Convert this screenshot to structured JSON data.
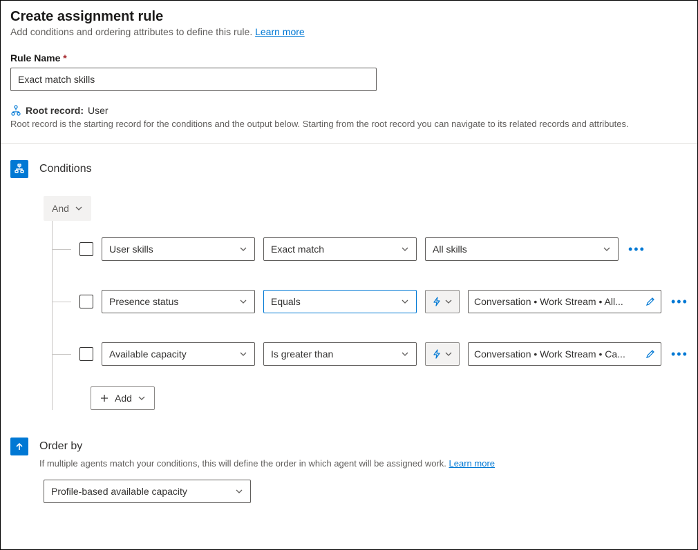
{
  "header": {
    "title": "Create assignment rule",
    "subtitle_prefix": "Add conditions and ordering attributes to define this rule. ",
    "learn_more": "Learn more"
  },
  "rule_name": {
    "label": "Rule Name",
    "required_mark": "*",
    "value": "Exact match skills"
  },
  "root_record": {
    "label": "Root record:",
    "value": "User",
    "description": "Root record is the starting record for the conditions and the output below. Starting from the root record you can navigate to its related records and attributes."
  },
  "conditions": {
    "title": "Conditions",
    "group_operator": "And",
    "rows": [
      {
        "field": "User skills",
        "operator": "Exact match",
        "value_type": "static",
        "value": "All skills"
      },
      {
        "field": "Presence status",
        "operator": "Equals",
        "operator_focused": true,
        "value_type": "dynamic",
        "value": "Conversation • Work Stream • All..."
      },
      {
        "field": "Available capacity",
        "operator": "Is greater than",
        "value_type": "dynamic",
        "value": "Conversation • Work Stream • Ca..."
      }
    ],
    "add_label": "Add"
  },
  "order_by": {
    "title": "Order by",
    "description_prefix": "If multiple agents match your conditions, this will define the order in which agent will be assigned work. ",
    "learn_more": "Learn more",
    "value": "Profile-based available capacity"
  }
}
